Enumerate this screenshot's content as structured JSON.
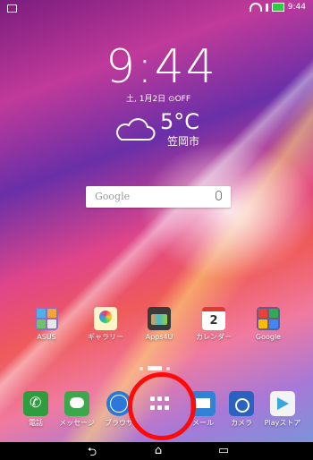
{
  "status_bar": {
    "time": "9:44"
  },
  "clock": {
    "time": "9:44",
    "date": "土, 1月2日 ⊙OFF"
  },
  "weather": {
    "temperature": "5°C",
    "city": "笠岡市",
    "icon": "cloud-icon"
  },
  "search": {
    "placeholder": "Google",
    "icon": "mic-icon"
  },
  "home_apps": [
    {
      "label": "ASUS",
      "icon": "asus-folder-icon"
    },
    {
      "label": "ギャラリー",
      "icon": "gallery-icon"
    },
    {
      "label": "Apps4U",
      "icon": "apps4u-icon"
    },
    {
      "label": "カレンダー",
      "icon": "calendar-icon",
      "badge": "2"
    },
    {
      "label": "Google",
      "icon": "google-folder-icon"
    }
  ],
  "dock": [
    {
      "label": "電話",
      "icon": "phone-icon"
    },
    {
      "label": "メッセージ",
      "icon": "message-icon"
    },
    {
      "label": "ブラウザ",
      "icon": "browser-icon"
    },
    {
      "label": "",
      "icon": "all-apps-icon"
    },
    {
      "label": "メール",
      "icon": "mail-icon"
    },
    {
      "label": "カメラ",
      "icon": "camera-icon"
    },
    {
      "label": "Playストア",
      "icon": "play-store-icon"
    }
  ],
  "navigation": {
    "back": "⮌",
    "home": "⌂",
    "recent": "▭"
  },
  "colors": {
    "highlight": "#ff0a0a",
    "navbar": "#000000"
  }
}
